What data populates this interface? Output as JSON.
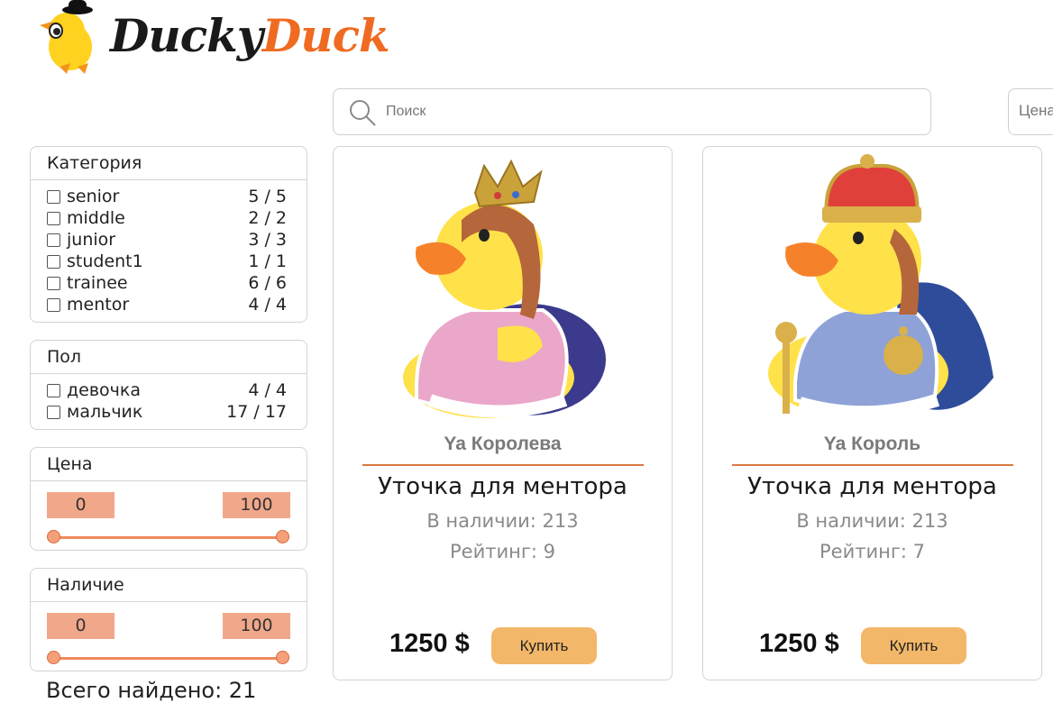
{
  "logo": {
    "word1": "Ducky",
    "word2": "Duck"
  },
  "search": {
    "placeholder": "Поиск",
    "value": ""
  },
  "sort": {
    "label": "Цена"
  },
  "filters": {
    "category": {
      "title": "Категория",
      "options": [
        {
          "label": "senior",
          "count": "5 / 5"
        },
        {
          "label": "middle",
          "count": "2 / 2"
        },
        {
          "label": "junior",
          "count": "3 / 3"
        },
        {
          "label": "student1",
          "count": "1 / 1"
        },
        {
          "label": "trainee",
          "count": "6 / 6"
        },
        {
          "label": "mentor",
          "count": "4 / 4"
        }
      ]
    },
    "gender": {
      "title": "Пол",
      "options": [
        {
          "label": "девочка",
          "count": "4 / 4"
        },
        {
          "label": "мальчик",
          "count": "17 / 17"
        }
      ]
    },
    "price": {
      "title": "Цена",
      "min": "0",
      "max": "100"
    },
    "stock": {
      "title": "Наличие",
      "min": "0",
      "max": "100"
    }
  },
  "total": "Всего найдено: 21",
  "products": [
    {
      "name": "Ya Королева",
      "description": "Уточка для ментора",
      "stock": "В наличии: 213",
      "rating": "Рейтинг: 9",
      "price": "1250 $",
      "buy_label": "Купить"
    },
    {
      "name": "Ya Король",
      "description": "Уточка для ментора",
      "stock": "В наличии: 213",
      "rating": "Рейтинг: 7",
      "price": "1250 $",
      "buy_label": "Купить"
    }
  ],
  "colors": {
    "accent": "#ef6b22",
    "button": "#f3b769",
    "range": "#f1a78a",
    "divider": "#d9773f"
  }
}
